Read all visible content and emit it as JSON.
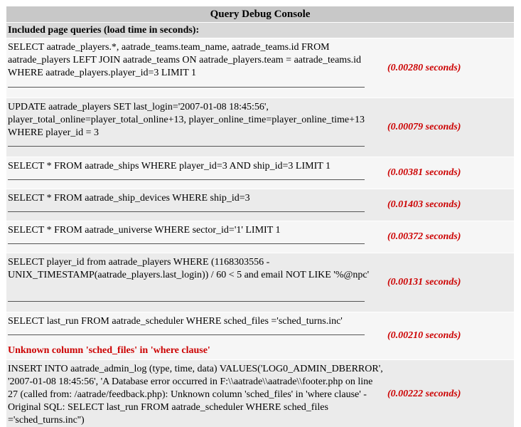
{
  "console": {
    "title": "Query Debug Console",
    "section_label": "Included page queries (load time in seconds):"
  },
  "queries": [
    {
      "sql": "SELECT aatrade_players.*, aatrade_teams.team_name, aatrade_teams.id FROM aatrade_players LEFT JOIN aatrade_teams ON aatrade_players.team = aatrade_teams.id WHERE aatrade_players.player_id=3 LIMIT 1",
      "time": "(0.00280 seconds)"
    },
    {
      "sql": "UPDATE aatrade_players SET last_login='2007-01-08 18:45:56', player_total_online=player_total_online+13, player_online_time=player_online_time+13 WHERE player_id = 3",
      "time": "(0.00079 seconds)"
    },
    {
      "sql": "SELECT * FROM aatrade_ships WHERE player_id=3 AND ship_id=3 LIMIT 1",
      "time": "(0.00381 seconds)"
    },
    {
      "sql": "SELECT * FROM aatrade_ship_devices WHERE ship_id=3",
      "time": "(0.01403 seconds)"
    },
    {
      "sql": "SELECT * FROM aatrade_universe WHERE sector_id='1' LIMIT 1",
      "time": "(0.00372 seconds)"
    },
    {
      "sql": "SELECT player_id from aatrade_players WHERE (1168303556 - UNIX_TIMESTAMP(aatrade_players.last_login)) / 60 < 5 and email NOT LIKE '%@npc'",
      "time": "(0.00131 seconds)"
    },
    {
      "sql": "SELECT last_run FROM aatrade_scheduler WHERE sched_files ='sched_turns.inc'",
      "time": "(0.00210 seconds)",
      "error": "Unknown column 'sched_files' in 'where clause'"
    },
    {
      "sql": "INSERT INTO aatrade_admin_log (type, time, data) VALUES('LOG0_ADMIN_DBERROR', '2007-01-08 18:45:56', 'A Database error occurred in F:\\\\aatrade\\\\aatrade\\\\footer.php on line 27 (called from: /aatrade/feedback.php): Unknown column 'sched_files' in 'where clause' - Original SQL: SELECT last_run FROM aatrade_scheduler WHERE sched_files ='sched_turns.inc'')",
      "time": "(0.00222 seconds)"
    }
  ]
}
